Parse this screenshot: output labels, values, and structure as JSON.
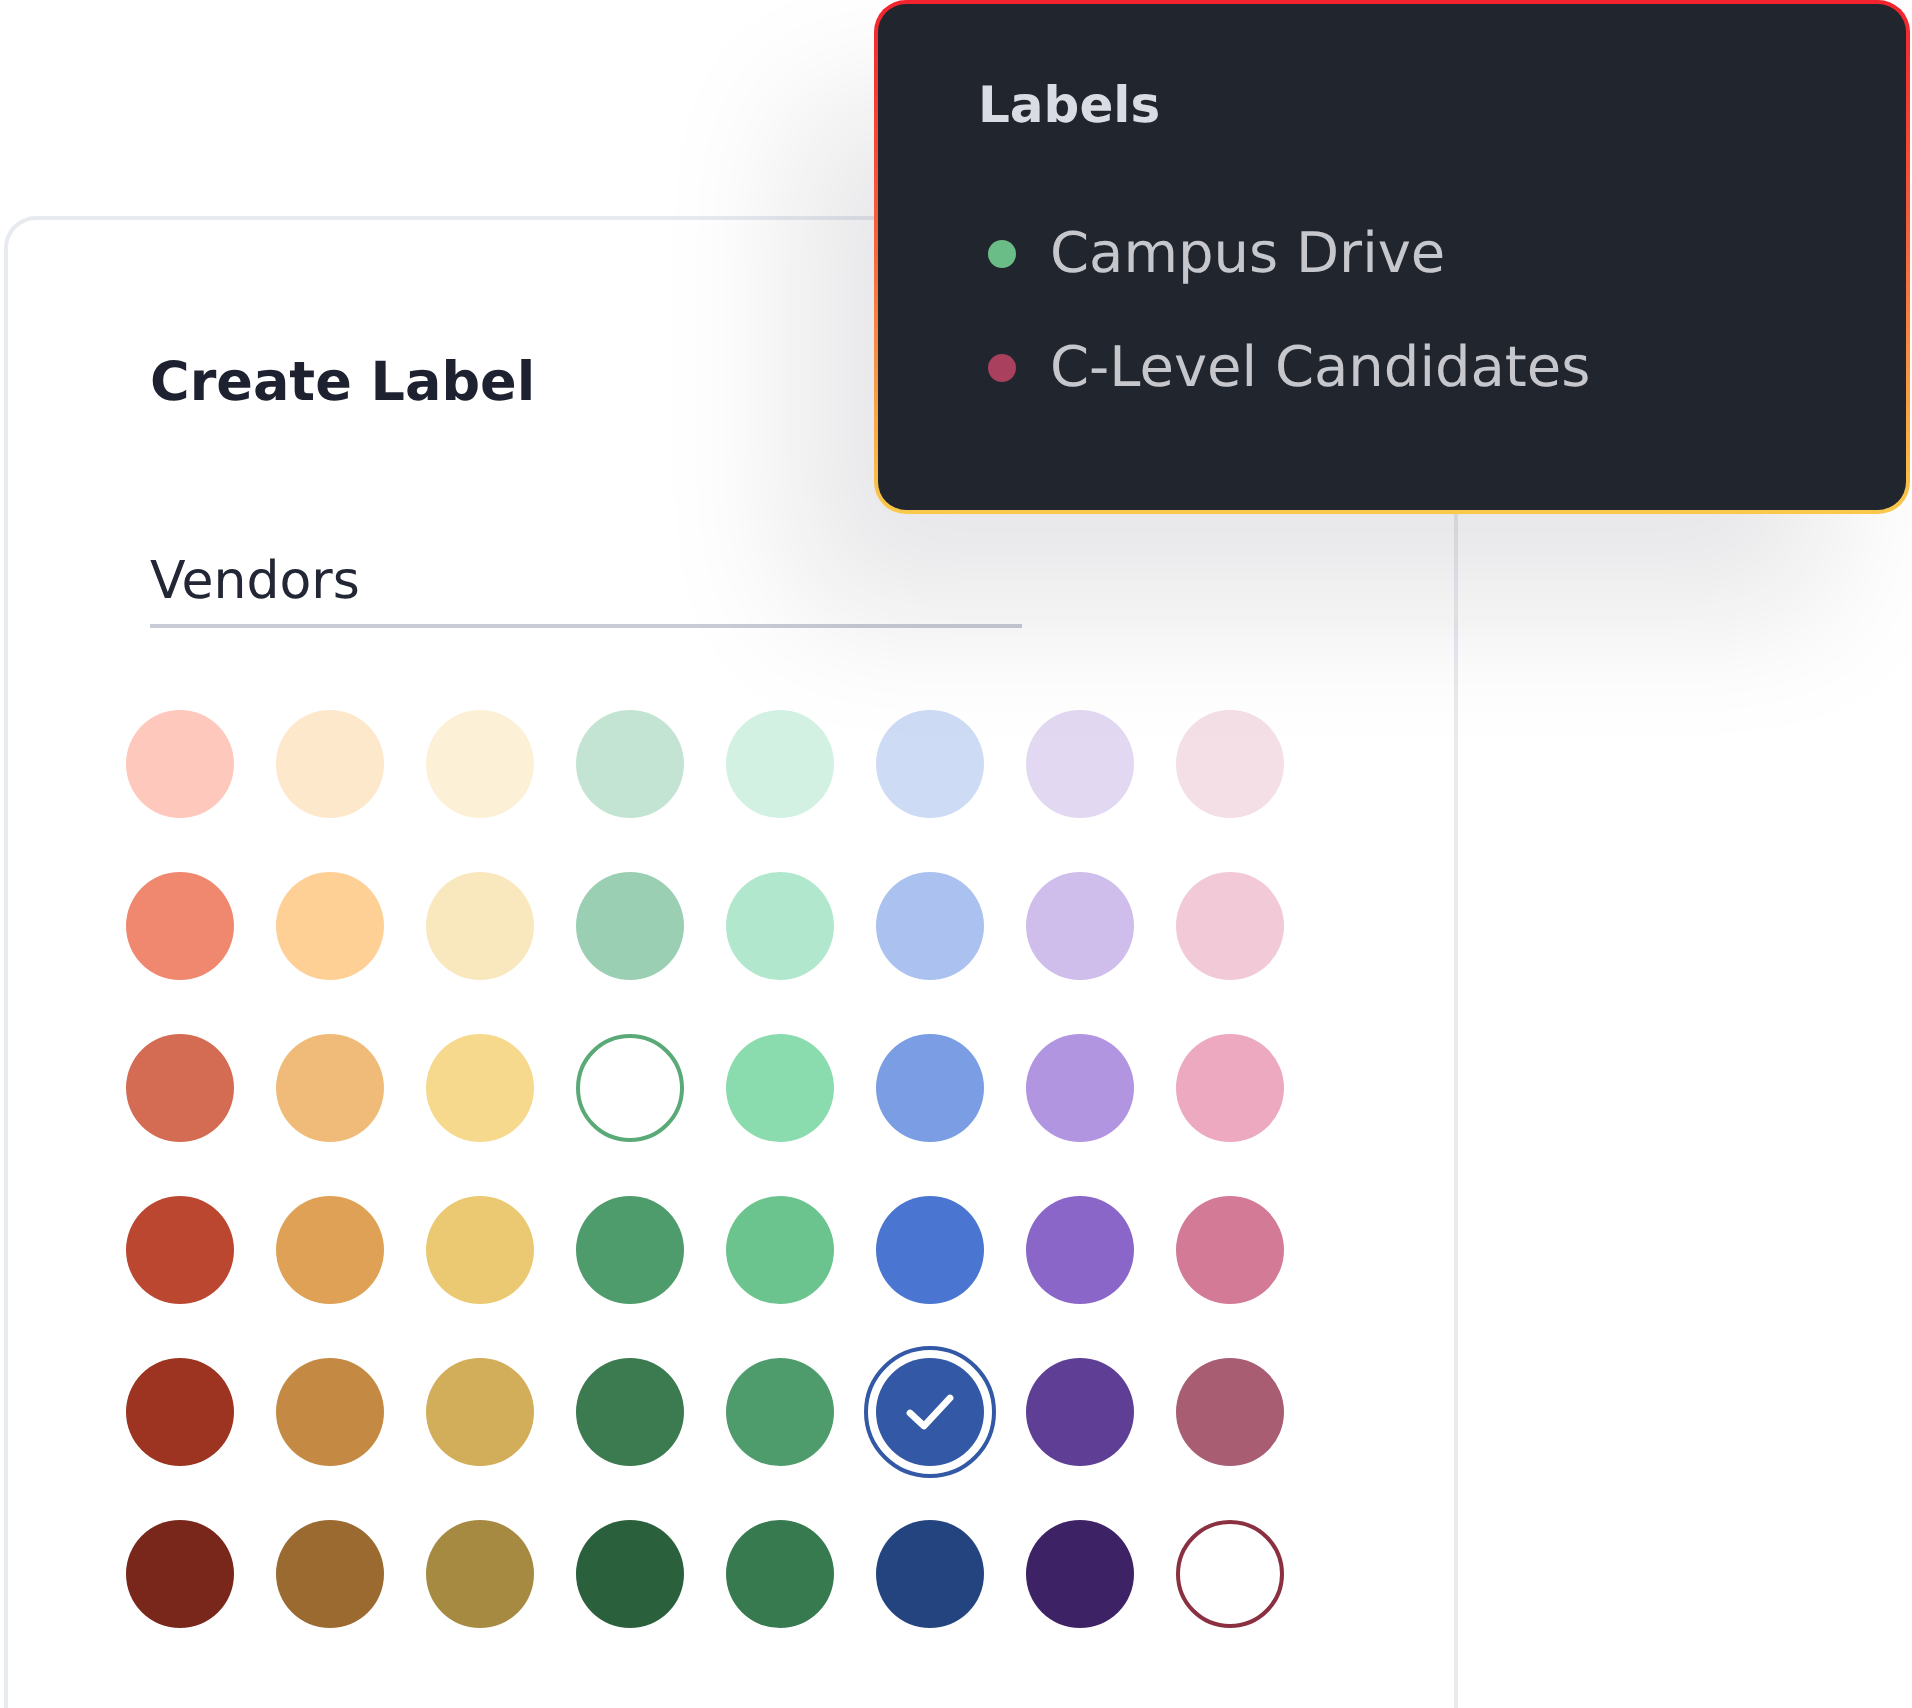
{
  "create_label": {
    "title": "Create Label",
    "name_field": {
      "value": "Vendors"
    },
    "swatches": [
      {
        "color": "#fec8bc",
        "selected": false,
        "outlined": false
      },
      {
        "color": "#fee8cb",
        "selected": false,
        "outlined": false
      },
      {
        "color": "#fcf0d6",
        "selected": false,
        "outlined": false
      },
      {
        "color": "#c4e4d3",
        "selected": false,
        "outlined": false
      },
      {
        "color": "#d2f1e2",
        "selected": false,
        "outlined": false
      },
      {
        "color": "#cedbf5",
        "selected": false,
        "outlined": false
      },
      {
        "color": "#e2d8f2",
        "selected": false,
        "outlined": false
      },
      {
        "color": "#f5dfe6",
        "selected": false,
        "outlined": false
      },
      {
        "color": "#f08870",
        "selected": false,
        "outlined": false
      },
      {
        "color": "#fed096",
        "selected": false,
        "outlined": false
      },
      {
        "color": "#f9e7bd",
        "selected": false,
        "outlined": false
      },
      {
        "color": "#9bcfb4",
        "selected": false,
        "outlined": false
      },
      {
        "color": "#b1e8cd",
        "selected": false,
        "outlined": false
      },
      {
        "color": "#abc1ef",
        "selected": false,
        "outlined": false
      },
      {
        "color": "#cfbdeb",
        "selected": false,
        "outlined": false
      },
      {
        "color": "#f2c9d7",
        "selected": false,
        "outlined": false
      },
      {
        "color": "#d46b53",
        "selected": false,
        "outlined": false
      },
      {
        "color": "#f0bb78",
        "selected": false,
        "outlined": false
      },
      {
        "color": "#f6d98c",
        "selected": false,
        "outlined": false
      },
      {
        "color": "#5aaa78",
        "selected": false,
        "outlined": true
      },
      {
        "color": "#8adcae",
        "selected": false,
        "outlined": false
      },
      {
        "color": "#7a9de3",
        "selected": false,
        "outlined": false
      },
      {
        "color": "#b295e0",
        "selected": false,
        "outlined": false
      },
      {
        "color": "#eca9bf",
        "selected": false,
        "outlined": false
      },
      {
        "color": "#bb4731",
        "selected": false,
        "outlined": false
      },
      {
        "color": "#dea156",
        "selected": false,
        "outlined": false
      },
      {
        "color": "#eac972",
        "selected": false,
        "outlined": false
      },
      {
        "color": "#4e9b6b",
        "selected": false,
        "outlined": false
      },
      {
        "color": "#6bc38d",
        "selected": false,
        "outlined": false
      },
      {
        "color": "#4a75d0",
        "selected": false,
        "outlined": false
      },
      {
        "color": "#8966c8",
        "selected": false,
        "outlined": false
      },
      {
        "color": "#d27a96",
        "selected": false,
        "outlined": false
      },
      {
        "color": "#9d3421",
        "selected": false,
        "outlined": false
      },
      {
        "color": "#c48a44",
        "selected": false,
        "outlined": false
      },
      {
        "color": "#d2ae5a",
        "selected": false,
        "outlined": false
      },
      {
        "color": "#3c7a50",
        "selected": false,
        "outlined": false
      },
      {
        "color": "#4e9b6b",
        "selected": false,
        "outlined": false
      },
      {
        "color": "#3358a5",
        "selected": true,
        "outlined": false
      },
      {
        "color": "#5f3e95",
        "selected": false,
        "outlined": false
      },
      {
        "color": "#a85d73",
        "selected": false,
        "outlined": false
      },
      {
        "color": "#79271a",
        "selected": false,
        "outlined": false
      },
      {
        "color": "#9b6a30",
        "selected": false,
        "outlined": false
      },
      {
        "color": "#a78a42",
        "selected": false,
        "outlined": false
      },
      {
        "color": "#2b603d",
        "selected": false,
        "outlined": false
      },
      {
        "color": "#377a4f",
        "selected": false,
        "outlined": false
      },
      {
        "color": "#24447f",
        "selected": false,
        "outlined": false
      },
      {
        "color": "#3d2266",
        "selected": false,
        "outlined": false
      },
      {
        "color": "#8a3040",
        "selected": false,
        "outlined": true
      }
    ]
  },
  "labels_popover": {
    "title": "Labels",
    "items": [
      {
        "name": "Campus Drive",
        "color": "#6abd86"
      },
      {
        "name": "C-Level Candidates",
        "color": "#a8405e"
      }
    ]
  }
}
